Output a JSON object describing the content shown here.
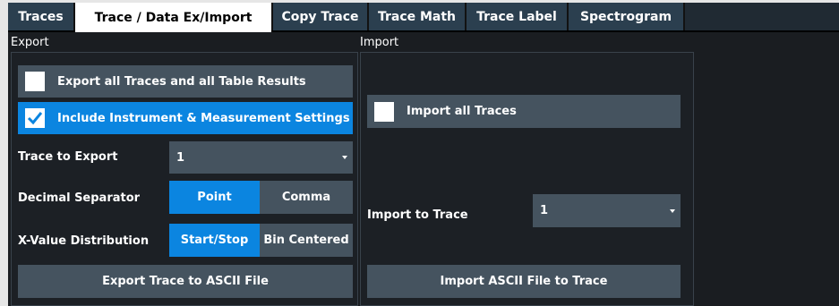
{
  "tabs": [
    {
      "label": "Traces",
      "active": false
    },
    {
      "label": "Trace / Data Ex/Import",
      "active": true
    },
    {
      "label": "Copy Trace",
      "active": false
    },
    {
      "label": "Trace Math",
      "active": false
    },
    {
      "label": "Trace Label",
      "active": false
    },
    {
      "label": "Spectrogram",
      "active": false
    }
  ],
  "export": {
    "title": "Export",
    "export_all": {
      "label": "Export all Traces and all Table Results",
      "checked": false
    },
    "include_settings": {
      "label": "Include Instrument & Measurement Settings",
      "checked": true
    },
    "trace_to_export": {
      "label": "Trace to Export",
      "value": "1"
    },
    "decimal_separator": {
      "label": "Decimal Separator",
      "options": [
        "Point",
        "Comma"
      ],
      "selected": "Point"
    },
    "x_value_distribution": {
      "label": "X-Value Distribution",
      "options": [
        "Start/Stop",
        "Bin Centered"
      ],
      "selected": "Start/Stop"
    },
    "export_button": "Export Trace to ASCII File"
  },
  "import": {
    "title": "Import",
    "import_all": {
      "label": "Import all Traces",
      "checked": false
    },
    "import_to_trace": {
      "label": "Import to Trace",
      "value": "1"
    },
    "import_button": "Import ASCII File to Trace"
  },
  "colors": {
    "accent": "#0b85e0",
    "button": "#45535f",
    "tab_bg": "#2b3f4f",
    "background": "#1a1d21"
  }
}
